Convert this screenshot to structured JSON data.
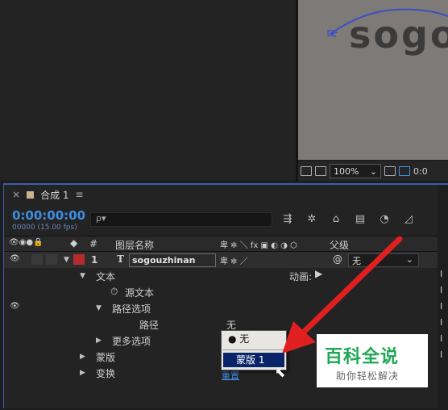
{
  "preview": {
    "text": "sogo",
    "zoom": "100%",
    "resolution_partial": "0:0"
  },
  "timeline": {
    "close_glyph": "×",
    "comp_tab": "合成 1",
    "tab_menu_glyph": "≡",
    "timecode": "0:00:00:00",
    "fps": "00000 (15.00 fps)",
    "search_glyph": "ρ▾",
    "headers": {
      "hash": "#",
      "layer_name": "图层名称",
      "parent": "父级"
    },
    "layer": {
      "number": "1",
      "type_glyph": "T",
      "name": "sogouzhinan",
      "parent": "无"
    },
    "props": {
      "text": "文本",
      "animate": "动画:",
      "source_text": "源文本",
      "path_options": "路径选项",
      "path": "路径",
      "path_value": "无",
      "more_options": "更多选项",
      "masks": "蒙版",
      "transform": "变换",
      "reset": "重置"
    },
    "menu": {
      "none": "无",
      "mask1": "蒙版 1"
    }
  },
  "watermark": {
    "title": "百科全说",
    "subtitle": "助你轻松解决"
  },
  "colors": {
    "accent": "#3d8fe6",
    "label_red": "#b62c2c",
    "arrow": "#e02020",
    "menu_highlight": "#0a246a",
    "watermark_green": "#1fa855"
  }
}
